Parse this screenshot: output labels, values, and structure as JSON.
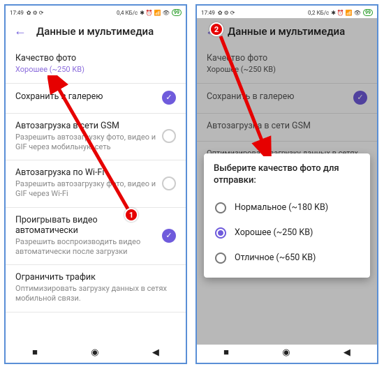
{
  "status": {
    "time": "17:49",
    "net1": "0,4 КБ/с",
    "net2": "0,2 КБ/с",
    "batt": "99"
  },
  "header": {
    "title": "Данные и мультимедиа"
  },
  "sections": {
    "quality": {
      "title": "Качество фото",
      "sub": "Хорошее (~250 KB)"
    },
    "gallery": {
      "title": "Сохранить в галерею"
    },
    "gsm": {
      "title": "Автозагрузка в сети GSM",
      "sub": "Разрешить автозагрузку фото, видео и GIF через мобильную сеть"
    },
    "wifi": {
      "title": "Автозагрузка по Wi-Fi",
      "sub": "Разрешить автозагрузку фото, видео и GIF через Wi-Fi"
    },
    "autoplay": {
      "title": "Проигрывать видео автоматически",
      "sub": "Разрешить воспроизводить видео автоматически после загрузки"
    },
    "traffic": {
      "title": "Ограничить трафик",
      "sub": "Оптимизировать загрузку данных в сетях мобильной связи."
    }
  },
  "dialog": {
    "title": "Выберите качество фото для отправки:",
    "options": [
      {
        "label": "Нормальное (~180 KB)",
        "selected": false
      },
      {
        "label": "Хорошее (~250 KB)",
        "selected": true
      },
      {
        "label": "Отличное (~650 KB)",
        "selected": false
      }
    ]
  },
  "badges": {
    "one": "1",
    "two": "2"
  }
}
